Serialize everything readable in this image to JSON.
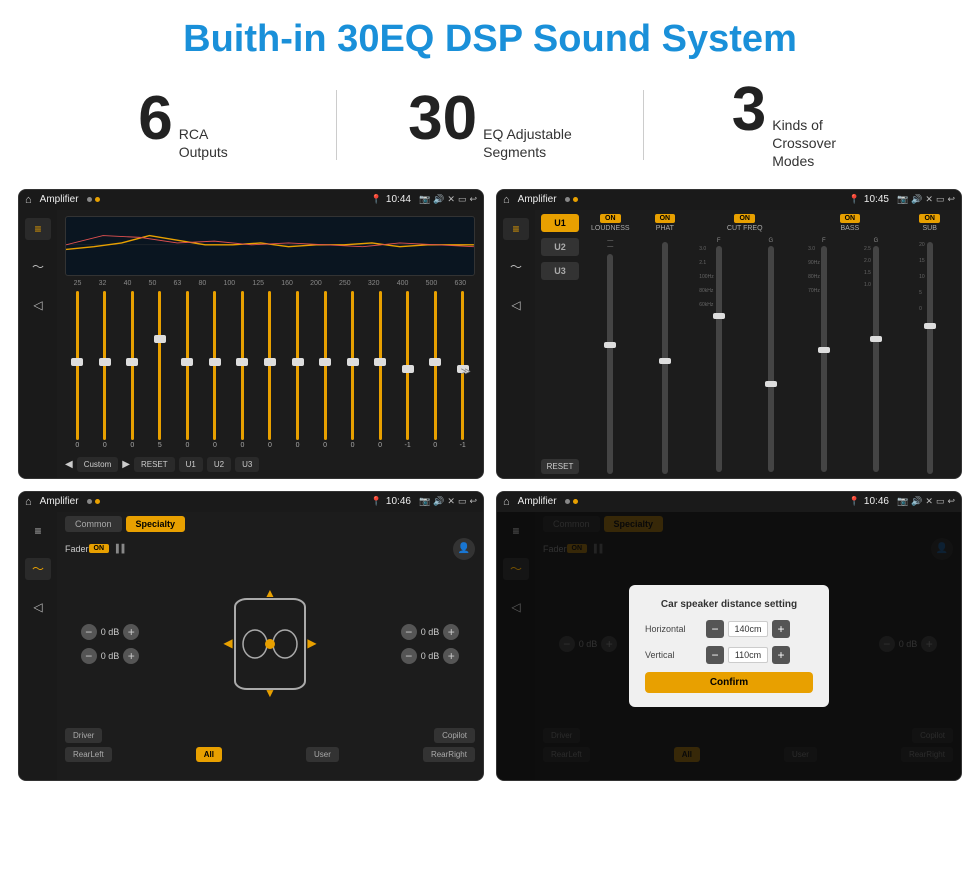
{
  "page": {
    "title": "Buith-in 30EQ DSP Sound System",
    "stats": [
      {
        "number": "6",
        "text": "RCA\nOutputs"
      },
      {
        "number": "30",
        "text": "EQ Adjustable\nSegments"
      },
      {
        "number": "3",
        "text": "Kinds of\nCrossover Modes"
      }
    ]
  },
  "screens": {
    "screen1": {
      "status": {
        "title": "Amplifier",
        "time": "10:44"
      },
      "eq_freqs": [
        "25",
        "32",
        "40",
        "50",
        "63",
        "80",
        "100",
        "125",
        "160",
        "200",
        "250",
        "320",
        "400",
        "500",
        "630"
      ],
      "eq_values": [
        "0",
        "0",
        "0",
        "5",
        "0",
        "0",
        "0",
        "0",
        "0",
        "0",
        "0",
        "0",
        "-1",
        "0",
        "-1"
      ],
      "eq_preset": "Custom",
      "buttons": [
        "RESET",
        "U1",
        "U2",
        "U3"
      ]
    },
    "screen2": {
      "status": {
        "title": "Amplifier",
        "time": "10:45"
      },
      "presets": [
        "U1",
        "U2",
        "U3"
      ],
      "channels": [
        "LOUDNESS",
        "PHAT",
        "CUT FREQ",
        "BASS",
        "SUB"
      ],
      "reset": "RESET"
    },
    "screen3": {
      "status": {
        "title": "Amplifier",
        "time": "10:46"
      },
      "tabs": [
        "Common",
        "Specialty"
      ],
      "fader_label": "Fader",
      "fader_on": "ON",
      "buttons": {
        "driver": "Driver",
        "copilot": "Copilot",
        "rearleft": "RearLeft",
        "all": "All",
        "user": "User",
        "rearright": "RearRight"
      },
      "db_values": [
        "0 dB",
        "0 dB",
        "0 dB",
        "0 dB"
      ]
    },
    "screen4": {
      "status": {
        "title": "Amplifier",
        "time": "10:46"
      },
      "tabs": [
        "Common",
        "Specialty"
      ],
      "dialog": {
        "title": "Car speaker distance setting",
        "horizontal_label": "Horizontal",
        "horizontal_value": "140cm",
        "vertical_label": "Vertical",
        "vertical_value": "110cm",
        "confirm": "Confirm"
      },
      "buttons": {
        "driver": "Driver",
        "copilot": "Copilot",
        "rearleft": "RearLeft",
        "rearright": "RearRight"
      },
      "db_values": [
        "0 dB",
        "0 dB"
      ]
    }
  }
}
